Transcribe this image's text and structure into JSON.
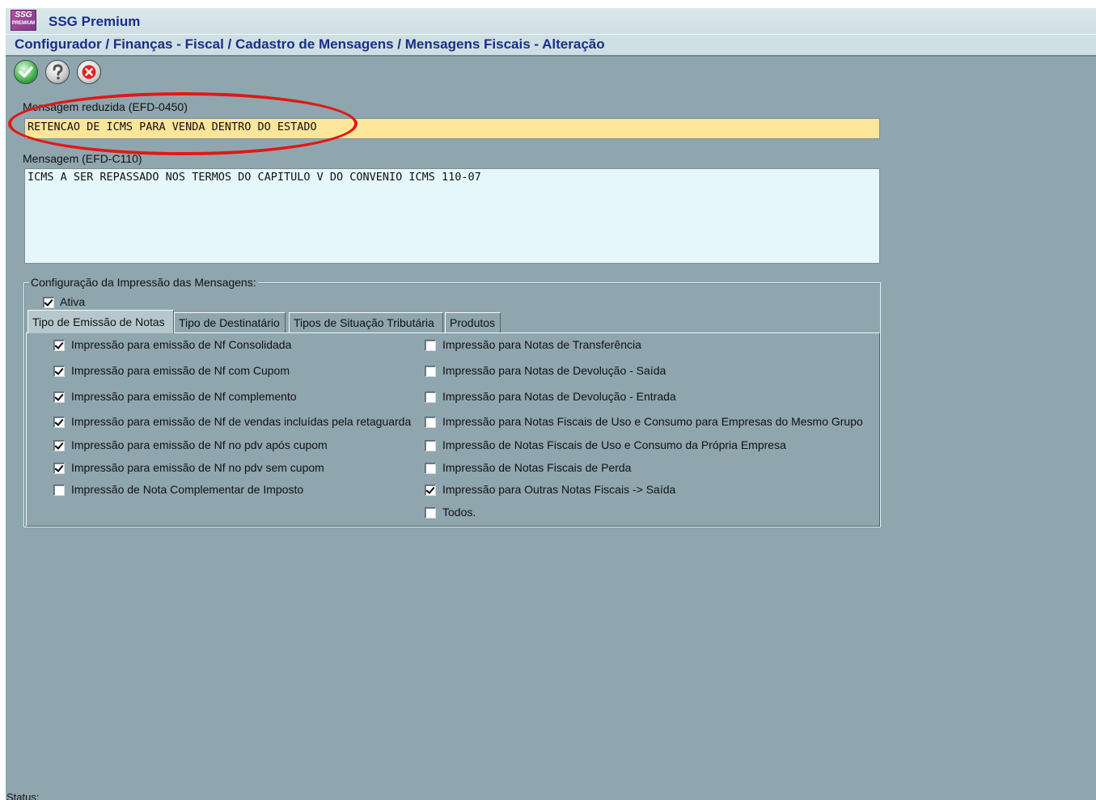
{
  "app": {
    "title": "SSG Premium",
    "logo_text": "SSG",
    "logo_subtext": "PREMIUM"
  },
  "breadcrumb": "Configurador / Finanças - Fiscal / Cadastro de Mensagens / Mensagens Fiscais - Alteração",
  "toolbar": {
    "confirm_icon": "check-icon",
    "help_icon": "question-icon",
    "cancel_icon": "close-icon"
  },
  "form": {
    "short_label": "Mensagem reduzida (EFD-0450)",
    "short_value": "RETENCAO DE ICMS PARA VENDA DENTRO DO ESTADO",
    "long_label": "Mensagem (EFD-C110)",
    "long_value": "ICMS A SER REPASSADO NOS TERMOS DO CAPITULO V DO CONVENIO ICMS 110-07"
  },
  "print_config": {
    "legend": "Configuração da Impressão das Mensagens:",
    "active_label": "Ativa",
    "active_checked": true,
    "tabs": [
      "Tipo de Emissão de Notas",
      "Tipo de Destinatário",
      "Tipos de Situação Tributária",
      "Produtos"
    ],
    "active_tab": "Tipo de Emissão de Notas",
    "left_options": [
      {
        "label": "Impressão  para emissão de Nf Consolidada",
        "checked": true
      },
      {
        "label": "Impressão para emissão de Nf com Cupom",
        "checked": true
      },
      {
        "label": "Impressão para emissão de Nf complemento",
        "checked": true
      },
      {
        "label": "Impressão para emissão de Nf de vendas incluídas pela retaguarda",
        "checked": true
      },
      {
        "label": "Impressão para emissão de Nf no  pdv após cupom",
        "checked": true
      },
      {
        "label": "Impressão para emissão de Nf no pdv sem cupom",
        "checked": true
      },
      {
        "label": "Impressão de Nota Complementar de Imposto",
        "checked": false
      }
    ],
    "right_options": [
      {
        "label": "Impressão para Notas de Transferência",
        "checked": false
      },
      {
        "label": "Impressão para Notas de Devolução - Saída",
        "checked": false
      },
      {
        "label": "Impressão para Notas de Devolução - Entrada",
        "checked": false
      },
      {
        "label": "Impressão para Notas Fiscais de Uso e Consumo para Empresas do Mesmo Grupo",
        "checked": false
      },
      {
        "label": "Impressão de Notas Fiscais de Uso e Consumo da Própria Empresa",
        "checked": false
      },
      {
        "label": "Impressão de Notas Fiscais de Perda",
        "checked": false
      },
      {
        "label": "Impressão para Outras Notas Fiscais -> Saída",
        "checked": true
      },
      {
        "label": "Todos.",
        "checked": false
      }
    ]
  },
  "status": {
    "label": "Status:"
  },
  "colors": {
    "annotation": "#e01818",
    "highlight_field": "#fde59a",
    "text_area": "#e6f7fb",
    "background": "#8fa6ae"
  }
}
